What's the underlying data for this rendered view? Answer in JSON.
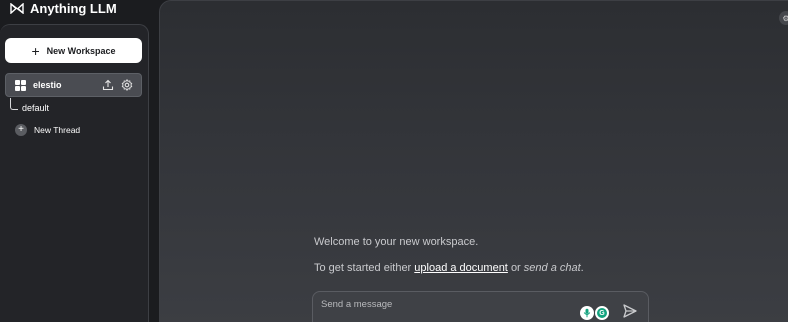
{
  "app": {
    "brand_name": "Anything LLM",
    "logo_icon": "anything-llm-logo"
  },
  "sidebar": {
    "new_workspace_label": "New Workspace",
    "workspaces": [
      {
        "name": "elestio",
        "icon": "workspace-grid-icon",
        "actions": [
          "upload-icon",
          "gear-icon"
        ],
        "threads": [
          {
            "label": "default"
          }
        ]
      }
    ],
    "new_thread_label": "New Thread"
  },
  "main": {
    "welcome_text": "Welcome to your new workspace.",
    "get_started": {
      "prefix": "To get started either",
      "upload_link": "upload a document",
      "middle": "or",
      "chat_link": "send a chat",
      "suffix": "."
    },
    "composer": {
      "placeholder": "Send a message",
      "value": ""
    }
  },
  "colors": {
    "background": "#1b1c1f",
    "sidebar": "#232428",
    "active_workspace": "#4a4c52",
    "main_panel": "#35373c",
    "grammarly_green": "#14a37f"
  }
}
